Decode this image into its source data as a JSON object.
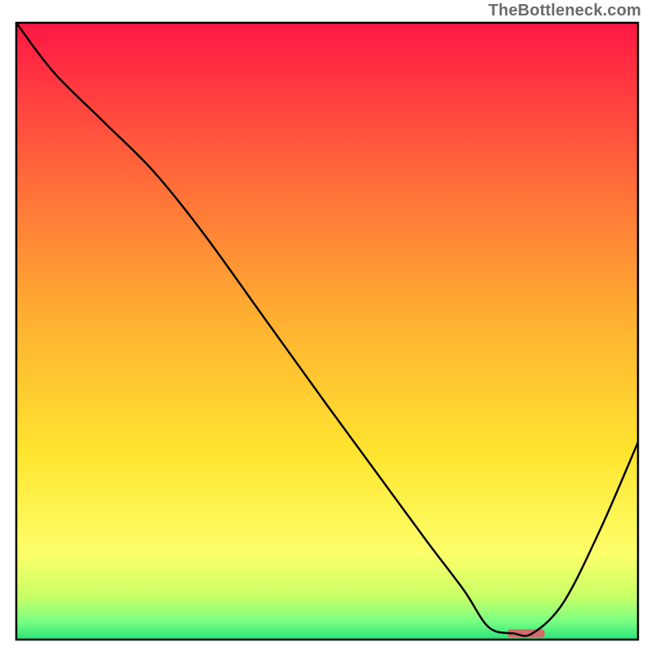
{
  "watermark": "TheBottleneck.com",
  "chart_data": {
    "type": "line",
    "title": "",
    "xlabel": "",
    "ylabel": "",
    "xlim": [
      0,
      100
    ],
    "ylim": [
      0,
      100
    ],
    "grid": false,
    "legend": false,
    "annotations": [],
    "background_gradient": {
      "direction": "vertical",
      "stops": [
        {
          "pos": 0.0,
          "color": "#ff1744"
        },
        {
          "pos": 0.25,
          "color": "#ff6a3a"
        },
        {
          "pos": 0.48,
          "color": "#ffb031"
        },
        {
          "pos": 0.7,
          "color": "#ffe52f"
        },
        {
          "pos": 0.86,
          "color": "#fdff6a"
        },
        {
          "pos": 0.93,
          "color": "#c9ff66"
        },
        {
          "pos": 0.97,
          "color": "#7bff82"
        },
        {
          "pos": 1.0,
          "color": "#29e27b"
        }
      ]
    },
    "series": [
      {
        "name": "bottleneck-curve",
        "x": [
          0,
          6,
          14,
          22,
          30,
          40,
          50,
          58,
          66,
          72,
          76,
          80,
          83,
          88,
          94,
          100
        ],
        "values": [
          100,
          92,
          84,
          76,
          66,
          52,
          38,
          27,
          16,
          8,
          2,
          1,
          1,
          6,
          18,
          32
        ]
      }
    ],
    "marker": {
      "name": "optimal-range-marker",
      "x_start": 79,
      "x_end": 85,
      "y": 1,
      "color": "#d46a6a"
    }
  }
}
